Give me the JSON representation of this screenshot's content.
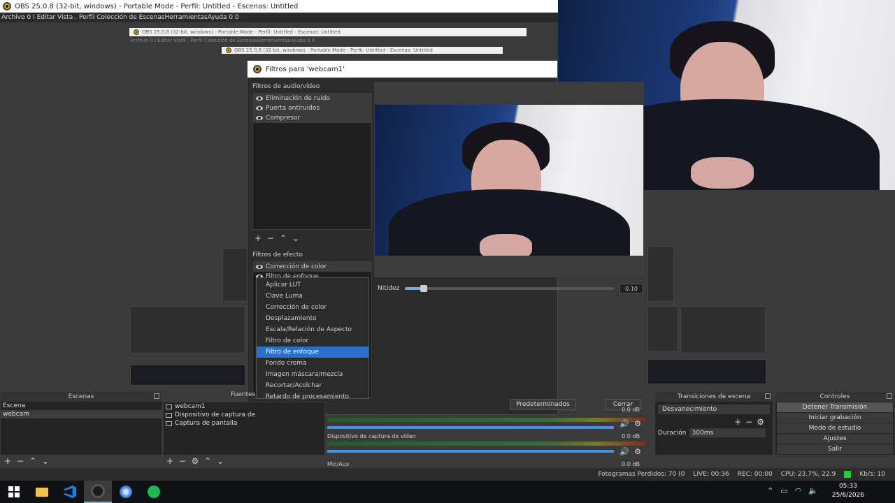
{
  "window": {
    "title": "OBS 25.0.8 (32-bit, windows) - Portable Mode - Perfil: Untitled - Escenas: Untitled"
  },
  "menubar": {
    "text": "Archivo 0 I Editar Vista . Perfil Colección de EscenasHerramientasAyuda 0 0"
  },
  "nested": {
    "title1": "OBS 25.0.8 (32-bit, windows) - Portable Mode - Perfil: Untitled - Escenas: Untitled",
    "menu1": "Archivo 0 I Editar Vista . Perfil Colección de EscenasHerramientasAyuda 0 0",
    "title2": "OBS 25.0.8 (32-bit, windows) - Portable Mode - Perfil: Untitled - Escenas: Untitled"
  },
  "dialog": {
    "title": "Filtros para 'webcam1'",
    "audio_video_label": "Filtros de audio/vídeo",
    "audio_filters": [
      "Eliminación de ruido",
      "Puerta antiruidos",
      "Compresor"
    ],
    "effect_label": "Filtros de efecto",
    "effect_filters": [
      "Corrección de color",
      "Filtro de enfoque"
    ],
    "slider_label": "Nitidez",
    "slider_value": "0.10",
    "slider_fraction": 0.09,
    "defaults_button": "Predeterminados",
    "close_button": "Cerrar"
  },
  "context_menu": {
    "items": [
      "Aplicar LUT",
      "Clave Luma",
      "Corrección de color",
      "Desplazamiento",
      "Escala/Relación de Aspecto",
      "Filtro de color",
      "Filtro de enfoque",
      "Fondo croma",
      "Imagen máscara/mezcla",
      "Recortar/Acolchar",
      "Retardo de procesamiento"
    ],
    "highlighted_index": 6
  },
  "scenes": {
    "title": "Escenas",
    "items": [
      "Escena",
      "webcam"
    ],
    "selected": 1
  },
  "sources": {
    "title": "Fuentes",
    "items": [
      "webcam1",
      "Dispositivo de captura de",
      "Captura de pantalla"
    ]
  },
  "mixer": {
    "rows": [
      {
        "label": "",
        "db": "0.0 dB"
      },
      {
        "label": "Dispositivo de captura de vídeo",
        "db": "0.0 dB"
      },
      {
        "label": "Mic/Aux",
        "db": "0.0 dB"
      }
    ]
  },
  "transitions": {
    "title": "Transiciones de escena",
    "selected": "Desvanecimiento",
    "duration_label": "Duración",
    "duration_value": "300ms"
  },
  "controls": {
    "title": "Controles",
    "buttons": [
      "Detener Transmisión",
      "Iniciar grabación",
      "Modo de estudio",
      "Ajustes",
      "Salir"
    ]
  },
  "status": {
    "dropped": "Fotogramas Perdidos: 70 (0",
    "live": "LIVE: 00:36",
    "rec": "REC: 00:00",
    "cpu": "CPU: 23.7%, 22.9",
    "kbps": "Kb/s: 10"
  },
  "taskbar": {
    "time": "05:33",
    "date": "25/6/2026"
  },
  "colors": {
    "accent": "#2a6fc9",
    "live_green": "#19d13a",
    "dialog_bg": "#2b2b2b"
  }
}
